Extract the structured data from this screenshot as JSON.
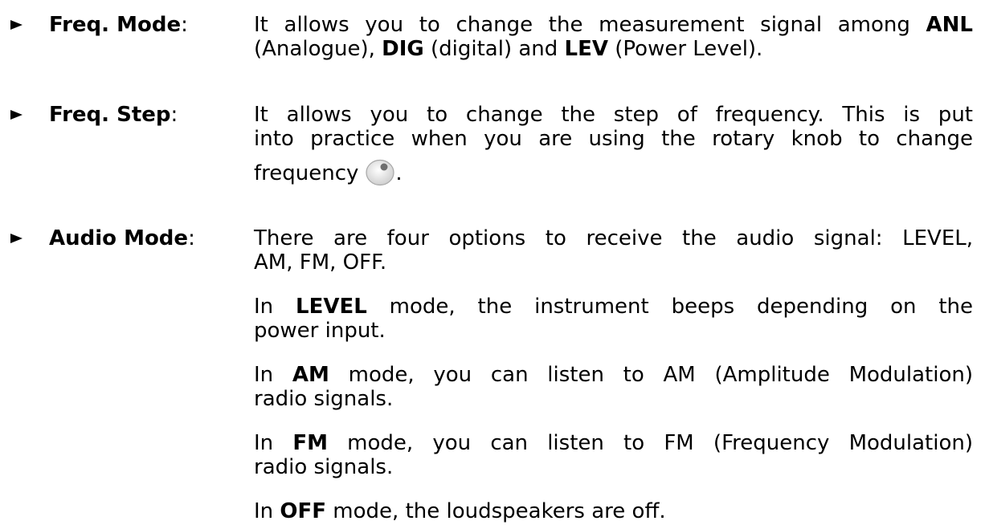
{
  "items": [
    {
      "term": "Freq. Mode",
      "colon": ":",
      "lines": [
        {
          "t1": "It allows you to change the measurement signal among ",
          "b1": "ANL"
        },
        {
          "t1": "(Analogue), ",
          "b1": "DIG",
          "t2": " (digital) and ",
          "b2": "LEV",
          "t3": " (Power Level)."
        }
      ]
    },
    {
      "term": "Freq. Step",
      "colon": ":",
      "lines": [
        "It allows you to change the step of frequency. This is put",
        "into practice when you are using the rotary knob to change",
        "frequency",
        "."
      ],
      "knob_icon": "rotary-knob-icon"
    },
    {
      "term": "Audio Mode",
      "colon": ":",
      "intro": [
        "There are four options to receive the audio signal: LEVEL,",
        "AM, FM, OFF."
      ],
      "modes": [
        {
          "pre": "In ",
          "bold": "LEVEL",
          "line1": " mode, the instrument beeps depending on the",
          "line2": "power input."
        },
        {
          "pre": "In ",
          "bold": "AM",
          "line1": " mode, you can listen to AM (Amplitude Modulation)",
          "line2": "radio signals."
        },
        {
          "pre": "In ",
          "bold": "FM",
          "line1": " mode, you can listen to FM (Frequency Modulation)",
          "line2": "radio signals."
        },
        {
          "pre": "In ",
          "bold": "OFF",
          "line1": " mode, the loudspeakers are off."
        }
      ]
    }
  ],
  "bullet_icon": "triangle-right-icon"
}
